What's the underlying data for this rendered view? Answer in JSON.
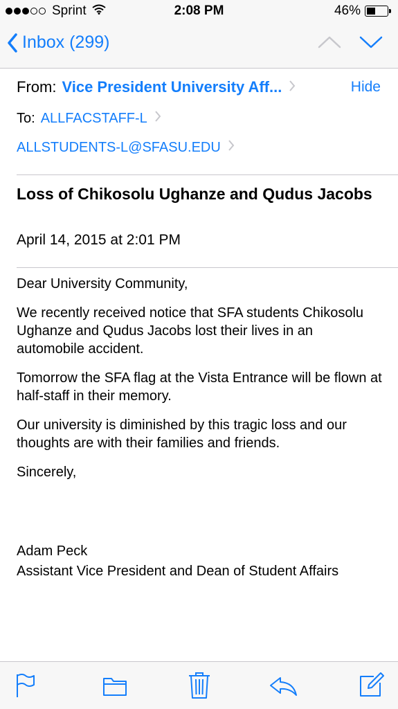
{
  "status_bar": {
    "carrier": "Sprint",
    "time": "2:08 PM",
    "battery_percent": "46%",
    "battery_level": 0.46,
    "signal_bars": 3,
    "signal_total": 5
  },
  "nav": {
    "back_label": "Inbox (299)",
    "prev_icon": "chevron-up-icon",
    "next_icon": "chevron-down-icon"
  },
  "header": {
    "from_label": "From:",
    "from_name": "Vice President University Aff...",
    "hide_label": "Hide",
    "to_label": "To:",
    "recipients": [
      "ALLFACSTAFF-L",
      "ALLSTUDENTS-L@SFASU.EDU"
    ]
  },
  "message": {
    "subject": "Loss of Chikosolu Ughanze and Qudus Jacobs",
    "date": "April 14, 2015 at 2:01 PM",
    "paragraphs": [
      "Dear University Community,",
      "We recently received notice that SFA students Chikosolu Ughanze and Qudus Jacobs lost their lives in an automobile accident.",
      "Tomorrow the SFA flag at the Vista Entrance will be flown at half-staff in their memory.",
      "Our university is diminished by this tragic loss and our thoughts are with their families and friends.",
      "Sincerely,"
    ],
    "signature": {
      "name": "Adam Peck",
      "title": "Assistant Vice President and Dean of Student Affairs"
    }
  },
  "toolbar": {
    "icons": [
      "flag-icon",
      "folder-icon",
      "trash-icon",
      "reply-icon",
      "compose-icon"
    ]
  },
  "colors": {
    "accent": "#147efb",
    "bar_background": "#f7f7f7",
    "separator": "#c8c7cc",
    "disabled_icon": "#c7c7cc"
  }
}
